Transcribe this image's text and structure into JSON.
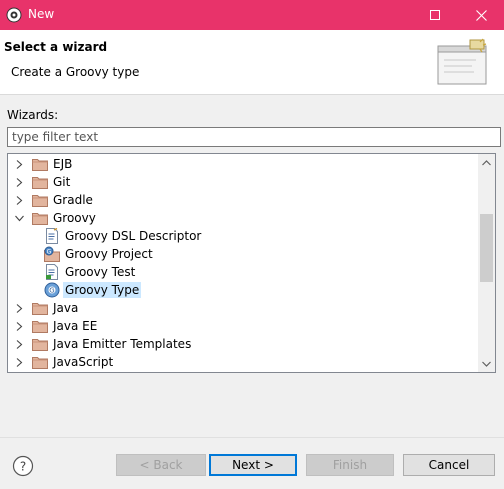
{
  "window": {
    "title": "New"
  },
  "banner": {
    "title": "Select a wizard",
    "description": "Create a Groovy type"
  },
  "wizards": {
    "label": "Wizards:",
    "filter_placeholder": "type filter text",
    "filter_value": ""
  },
  "tree": [
    {
      "label": "EJB",
      "icon": "folder-icon",
      "expanded": false
    },
    {
      "label": "Git",
      "icon": "folder-icon",
      "expanded": false
    },
    {
      "label": "Gradle",
      "icon": "folder-icon",
      "expanded": false
    },
    {
      "label": "Groovy",
      "icon": "folder-icon",
      "expanded": true
    },
    {
      "label": "Groovy DSL Descriptor",
      "icon": "dsl-descriptor-icon"
    },
    {
      "label": "Groovy Project",
      "icon": "groovy-project-icon"
    },
    {
      "label": "Groovy Test",
      "icon": "groovy-test-icon"
    },
    {
      "label": "Groovy Type",
      "icon": "groovy-type-icon",
      "selected": true
    },
    {
      "label": "Java",
      "icon": "folder-icon",
      "expanded": false
    },
    {
      "label": "Java EE",
      "icon": "folder-icon",
      "expanded": false
    },
    {
      "label": "Java Emitter Templates",
      "icon": "folder-icon",
      "expanded": false
    },
    {
      "label": "JavaScript",
      "icon": "folder-icon",
      "expanded": false
    }
  ],
  "buttons": {
    "back": "< Back",
    "next": "Next >",
    "finish": "Finish",
    "cancel": "Cancel"
  },
  "colors": {
    "titlebar": "#e8336a",
    "selection": "#cce8ff",
    "folder": "#d9a48a"
  }
}
